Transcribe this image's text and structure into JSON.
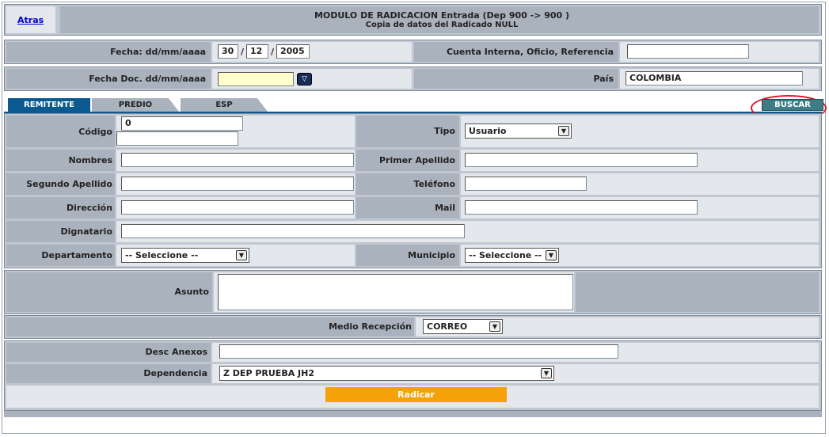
{
  "header": {
    "back_link": "Atras",
    "title": "MODULO DE RADICACION Entrada (Dep 900 -> 900 )",
    "subtitle": "Copia de datos del Radicado NULL"
  },
  "row1": {
    "fecha_label": "Fecha: dd/mm/aaaa",
    "day": "30",
    "month": "12",
    "year": "2005",
    "sep1": "/",
    "sep2": "/",
    "cuenta_label": "Cuenta Interna, Oficio, Referencia",
    "cuenta_value": ""
  },
  "row2": {
    "fecha_doc_label": "Fecha Doc. dd/mm/aaaa",
    "fecha_doc_value": "",
    "pais_label": "País",
    "pais_value": "COLOMBIA"
  },
  "tabs": [
    "REMITENTE",
    "PREDIO",
    "ESP"
  ],
  "buscar_label": "BUSCAR",
  "form": {
    "codigo_label": "Código",
    "codigo_value": "0",
    "tipo_label": "Tipo",
    "tipo_value": "Usuario",
    "nombres_label": "Nombres",
    "primer_apellido_label": "Primer Apellido",
    "segundo_apellido_label": "Segundo Apellido",
    "telefono_label": "Teléfono",
    "direccion_label": "Dirección",
    "mail_label": "Mail",
    "dignatario_label": "Dignatario",
    "departamento_label": "Departamento",
    "departamento_value": "-- Seleccione --",
    "municipio_label": "Municipio",
    "municipio_value": "-- Seleccione --"
  },
  "asunto_label": "Asunto",
  "medio": {
    "label": "Medio Recepción",
    "value": "CORREO"
  },
  "anexos": {
    "desc_label": "Desc Anexos",
    "dependencia_label": "Dependencia",
    "dependencia_value": "Z DEP PRUEBA JH2"
  },
  "radicar_label": "Radicar",
  "colors": {
    "accent": "#f4a10a",
    "tab_active": "#0b5a8f",
    "buscar_bg": "#3f7d86",
    "highlight": "#e0162b"
  }
}
